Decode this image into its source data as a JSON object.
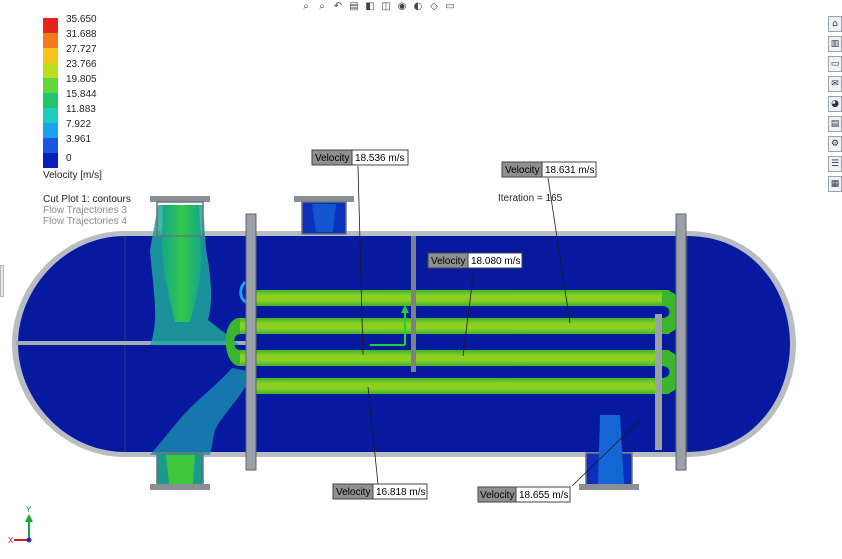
{
  "legend": {
    "ticks": [
      "35.650",
      "31.688",
      "27.727",
      "23.766",
      "19.805",
      "15.844",
      "11.883",
      "7.922",
      "3.961",
      "0"
    ],
    "colors": [
      "#e8231a",
      "#f4791c",
      "#f6c319",
      "#b8e01d",
      "#5fd73a",
      "#22c46a",
      "#18cfc0",
      "#1aa2ee",
      "#1a55e0",
      "#0a1fb8"
    ],
    "units_label": "Velocity [m/s]"
  },
  "plot_info": {
    "line1": "Cut Plot 1: contours",
    "line2": "Flow Trajectories 3",
    "line3": "Flow Trajectories 4"
  },
  "iteration_label": "Iteration = 165",
  "probes": [
    {
      "name": "Velocity",
      "value": "18.536 m/s"
    },
    {
      "name": "Velocity",
      "value": "18.631 m/s"
    },
    {
      "name": "Velocity",
      "value": "18.080 m/s"
    },
    {
      "name": "Velocity",
      "value": "16.818 m/s"
    },
    {
      "name": "Velocity",
      "value": "18.655 m/s"
    }
  ],
  "toolbar_icons": [
    "zoom-to-fit-icon",
    "zoom-area-icon",
    "previous-view-icon",
    "section-view-icon",
    "view-orientation-icon",
    "display-style-icon",
    "hide-show-icon",
    "appearance-icon",
    "scene-icon",
    "monitor-icon"
  ],
  "toolbar_glyphs": [
    "⌕",
    "⌕",
    "↶",
    "▤",
    "◧",
    "◫",
    "◉",
    "◐",
    "◇",
    "▭"
  ],
  "right_icons": [
    "home-icon",
    "part-icon",
    "folder-icon",
    "view-palette-icon",
    "appearance-icon",
    "properties-icon",
    "solve-icon",
    "task-list-icon",
    "results-icon"
  ],
  "right_glyphs": [
    "⌂",
    "▥",
    "▭",
    "✉",
    "◕",
    "▤",
    "⚙",
    "☰",
    "▦"
  ],
  "triad": {
    "x_label": "X",
    "y_label": "Y"
  },
  "colors": {
    "fluid": "#07199f",
    "shell": "#9da5ad",
    "tube_outer": "#39b92d",
    "tube_inner": "#9fd61d",
    "flange": "#8a8f96"
  }
}
